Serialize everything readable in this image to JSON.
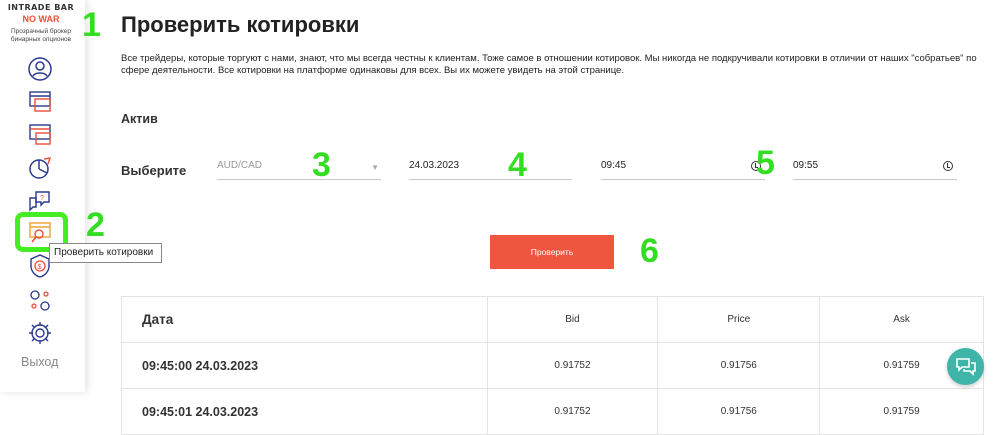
{
  "brand": {
    "logo": "INTRADE BAR",
    "banner": "NO WAR",
    "tagline": "Прозрачный брокер бинарных опционов"
  },
  "sidebar": {
    "items": [
      {
        "icon": "profile-icon"
      },
      {
        "icon": "deposit-icon"
      },
      {
        "icon": "withdraw-icon"
      },
      {
        "icon": "analytics-icon"
      },
      {
        "icon": "support-chat-icon"
      },
      {
        "icon": "check-quotes-icon",
        "tooltip": "Проверить котировки"
      },
      {
        "icon": "security-icon"
      },
      {
        "icon": "partners-icon"
      },
      {
        "icon": "settings-icon"
      }
    ],
    "logout": "Выход"
  },
  "page": {
    "title": "Проверить котировки",
    "description": "Все трейдеры, которые торгуют с нами, знают, что мы всегда честны к клиентам. Тоже самое в отношении котировок. Мы никогда не подкручивали котировки в отличии от наших \"собратьев\" по сфере деятельности. Все котировки на платформе одинаковы для всех. Вы их можете увидеть на этой странице.",
    "section_label": "Актив",
    "choose_label": "Выберите"
  },
  "form": {
    "asset": "AUD/CAD",
    "date": "24.03.2023",
    "time_from": "09:45",
    "time_to": "09:55",
    "submit": "Проверить"
  },
  "table": {
    "headers": [
      "Дата",
      "Bid",
      "Price",
      "Ask"
    ],
    "rows": [
      [
        "09:45:00 24.03.2023",
        "0.91752",
        "0.91756",
        "0.91759"
      ],
      [
        "09:45:01 24.03.2023",
        "0.91752",
        "0.91756",
        "0.91759"
      ]
    ]
  },
  "annotations": [
    "1",
    "2",
    "3",
    "4",
    "5",
    "6"
  ],
  "colors": {
    "accent": "#f0553f",
    "annotation": "#33dd22",
    "chat": "#3fb4a9",
    "icon": "#2a3a8c"
  }
}
